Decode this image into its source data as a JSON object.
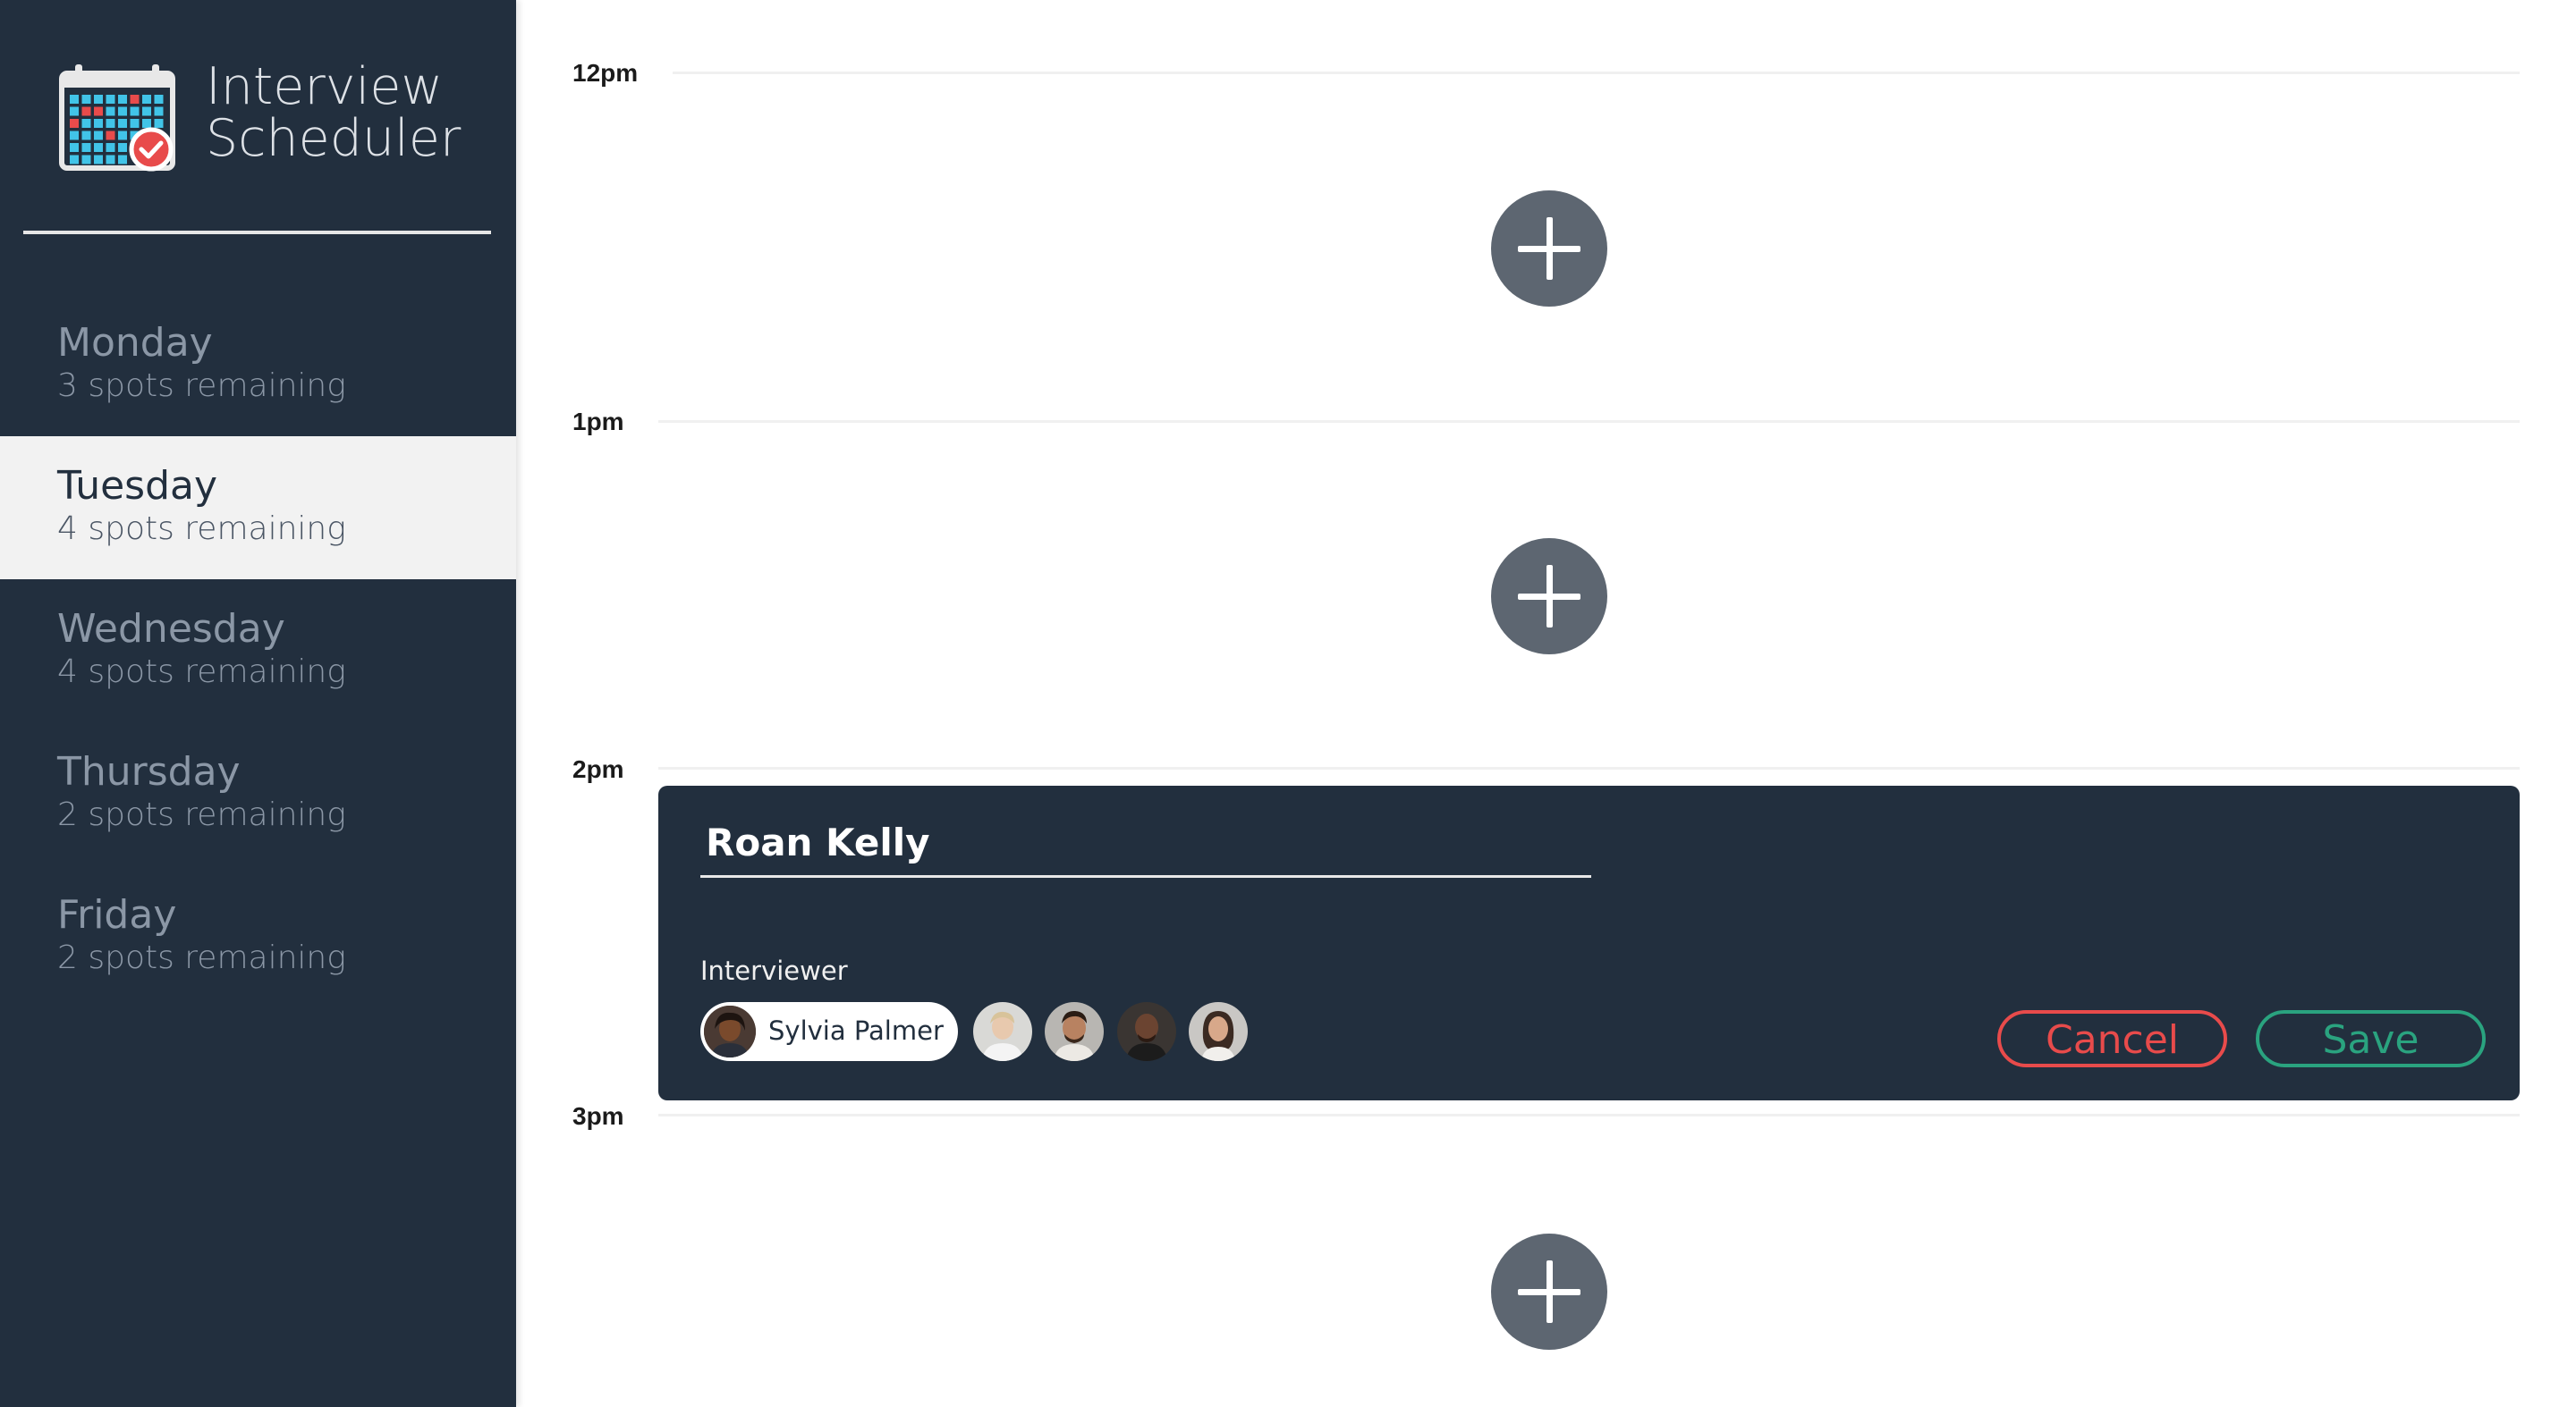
{
  "app": {
    "title": "Interview Scheduler",
    "logo_icon": "calendar-check-icon"
  },
  "sidebar": {
    "days": [
      {
        "name": "Monday",
        "spots": "3 spots remaining",
        "selected": false
      },
      {
        "name": "Tuesday",
        "spots": "4 spots remaining",
        "selected": true
      },
      {
        "name": "Wednesday",
        "spots": "4 spots remaining",
        "selected": false
      },
      {
        "name": "Thursday",
        "spots": "2 spots remaining",
        "selected": false
      },
      {
        "name": "Friday",
        "spots": "2 spots remaining",
        "selected": false
      }
    ]
  },
  "schedule": {
    "times": [
      "12pm",
      "1pm",
      "2pm",
      "3pm"
    ],
    "add_icon": "plus-icon"
  },
  "form": {
    "student_name": "Roan Kelly",
    "interviewer_label": "Interviewer",
    "selected_interviewer": "Sylvia Palmer",
    "other_interviewers_count": 4,
    "cancel_label": "Cancel",
    "save_label": "Save"
  },
  "colors": {
    "sidebar_bg": "#222f3e",
    "selected_day_bg": "#f2f2f2",
    "add_button": "#5d6671",
    "cancel": "#e84b4b",
    "save": "#2aa37f"
  }
}
